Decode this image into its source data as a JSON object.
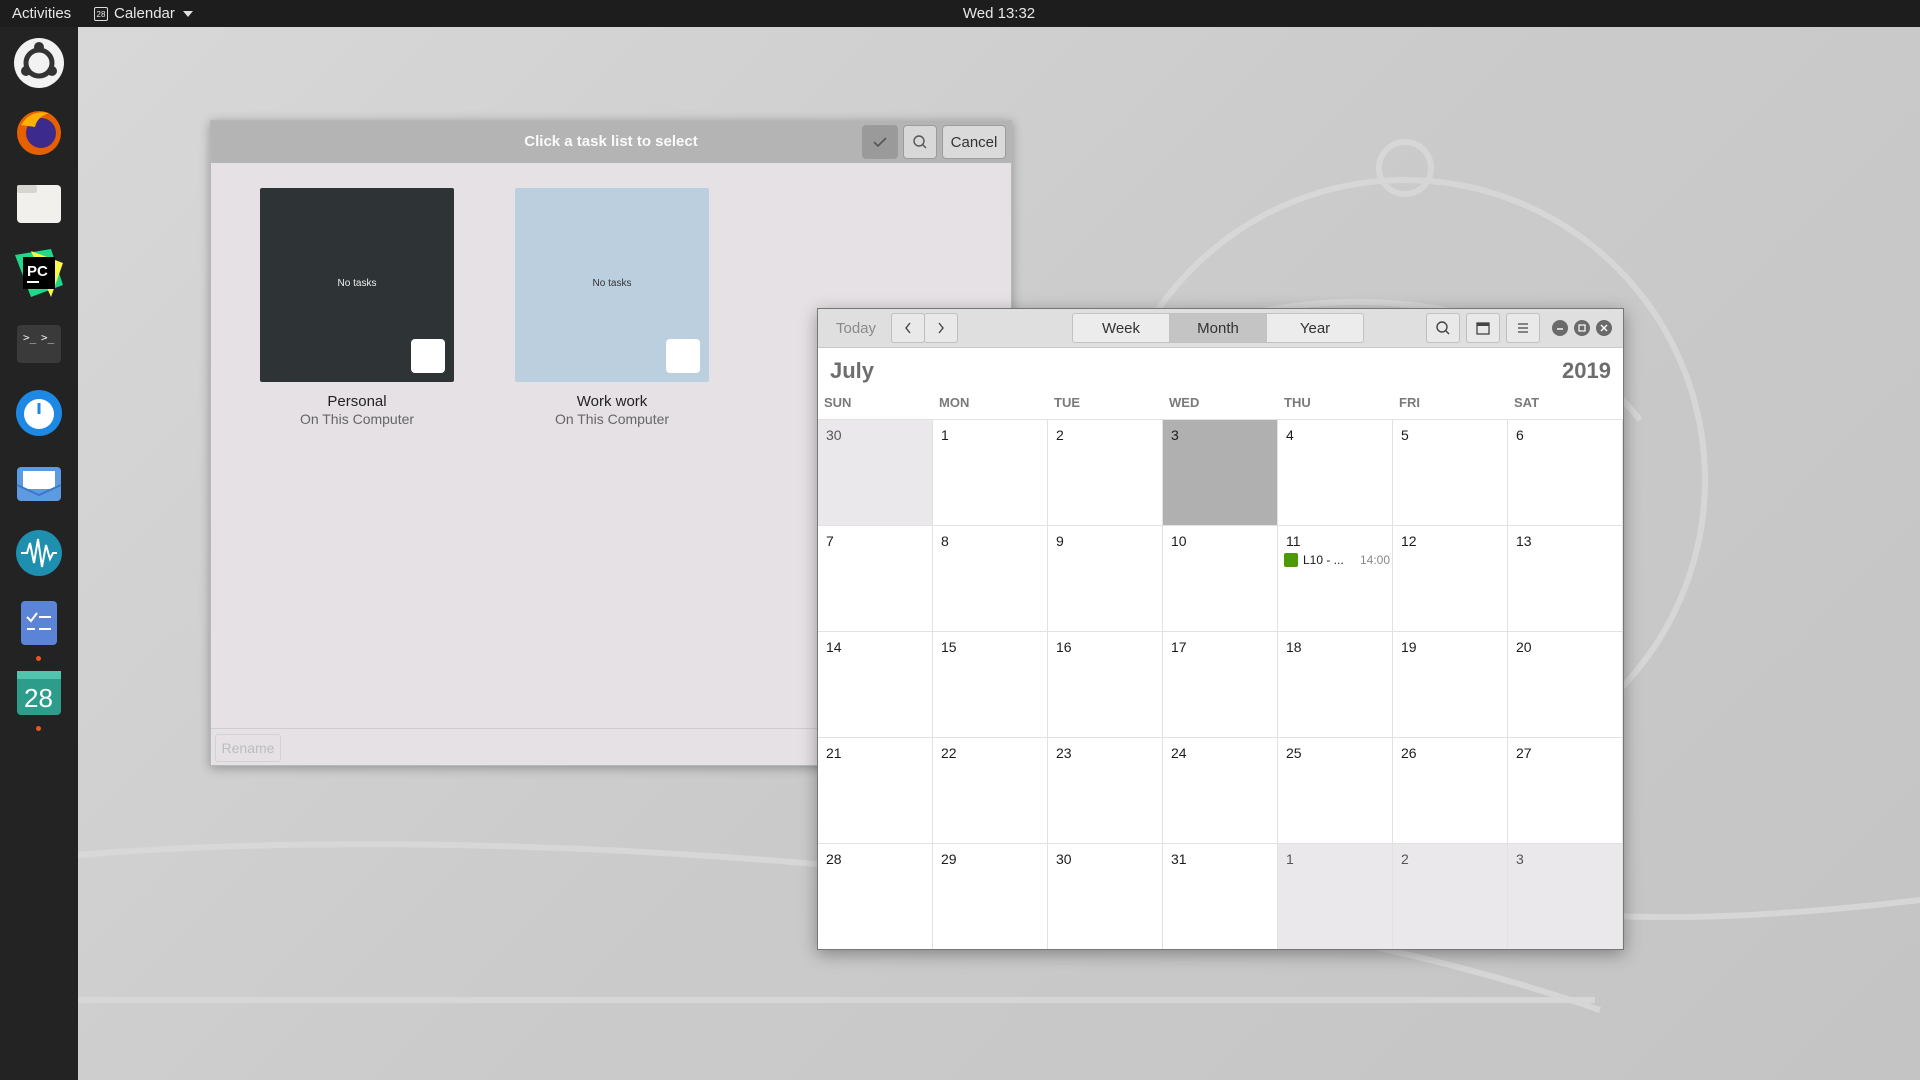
{
  "topbar": {
    "activities": "Activities",
    "app_name": "Calendar",
    "app_glyph": "28",
    "clock": "Wed 13:32"
  },
  "dock": {
    "items": [
      {
        "name": "ubuntu-icon"
      },
      {
        "name": "firefox-icon"
      },
      {
        "name": "files-icon"
      },
      {
        "name": "pycharm-icon",
        "label": "PC"
      },
      {
        "name": "terminal-icon"
      },
      {
        "name": "timer-icon"
      },
      {
        "name": "mail-icon"
      },
      {
        "name": "audio-icon"
      },
      {
        "name": "tasks-icon",
        "running": true
      },
      {
        "name": "calendar-icon",
        "label": "28",
        "running": true
      }
    ]
  },
  "task_dialog": {
    "title": "Click a task list to select",
    "cancel_label": "Cancel",
    "rename_label": "Rename",
    "lists": [
      {
        "name": "Personal",
        "subtitle": "On This Computer",
        "status": "No tasks",
        "color": "#2e3436"
      },
      {
        "name": "Work work",
        "subtitle": "On This Computer",
        "status": "No tasks",
        "color": "#bccfdf"
      }
    ]
  },
  "calendar": {
    "today_label": "Today",
    "views": {
      "week": "Week",
      "month": "Month",
      "year": "Year"
    },
    "active_view": "Month",
    "month": "July",
    "year": "2019",
    "weekdays": [
      "SUN",
      "MON",
      "TUE",
      "WED",
      "THU",
      "FRI",
      "SAT"
    ],
    "today_day": "3",
    "weeks": [
      [
        "30",
        "1",
        "2",
        "3",
        "4",
        "5",
        "6"
      ],
      [
        "7",
        "8",
        "9",
        "10",
        "11",
        "12",
        "13"
      ],
      [
        "14",
        "15",
        "16",
        "17",
        "18",
        "19",
        "20"
      ],
      [
        "21",
        "22",
        "23",
        "24",
        "25",
        "26",
        "27"
      ],
      [
        "28",
        "29",
        "30",
        "31",
        "1",
        "2",
        "3"
      ]
    ],
    "event": {
      "title": "L10 - ...",
      "time": "14:00",
      "day": "11",
      "color": "#4e9a06"
    }
  }
}
